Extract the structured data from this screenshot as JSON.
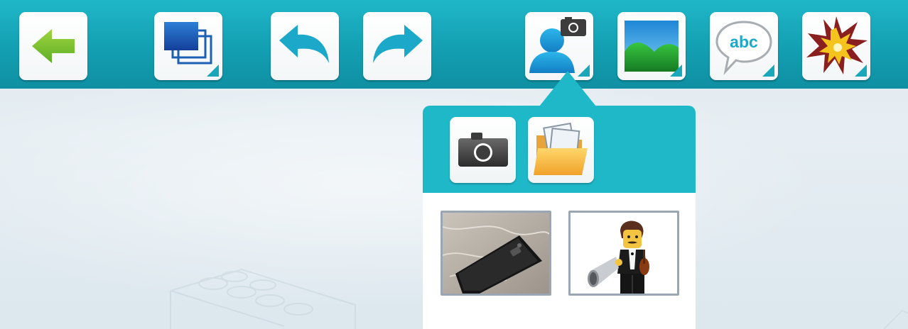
{
  "toolbar": {
    "buttons": [
      {
        "name": "back-button",
        "icon": "left-arrow-icon",
        "color": "#6dbb2f"
      },
      {
        "name": "layers-button",
        "icon": "layers-icon",
        "color": "#1d5fb8",
        "has_submenu": true
      },
      {
        "name": "undo-button",
        "icon": "undo-icon",
        "color": "#1aa7c8"
      },
      {
        "name": "redo-button",
        "icon": "redo-icon",
        "color": "#1aa7c8"
      },
      {
        "name": "add-character-button",
        "icon": "character-camera-icon",
        "color": "#1d9fd6",
        "has_submenu": true,
        "active": true
      },
      {
        "name": "add-background-button",
        "icon": "landscape-icon",
        "color": "#22a83a",
        "has_submenu": true
      },
      {
        "name": "add-text-button",
        "icon": "speech-bubble-icon",
        "label": "abc",
        "has_submenu": true
      },
      {
        "name": "add-effect-button",
        "icon": "explosion-icon",
        "color": "#f2c01b",
        "has_submenu": true
      }
    ]
  },
  "popup": {
    "accent": "#1eb8c9",
    "actions": [
      {
        "name": "take-photo-button",
        "icon": "camera-icon"
      },
      {
        "name": "open-folder-button",
        "icon": "folder-icon"
      }
    ],
    "thumbnails": [
      {
        "name": "thumbnail-phone-photo",
        "icon": "phone-photo"
      },
      {
        "name": "thumbnail-minifigure",
        "icon": "minifigure-with-megaphone"
      }
    ]
  },
  "colors": {
    "toolbar": "#139fb2",
    "canvas": "#e2ebf0",
    "thumbnail_border": "#9aa6b3"
  }
}
